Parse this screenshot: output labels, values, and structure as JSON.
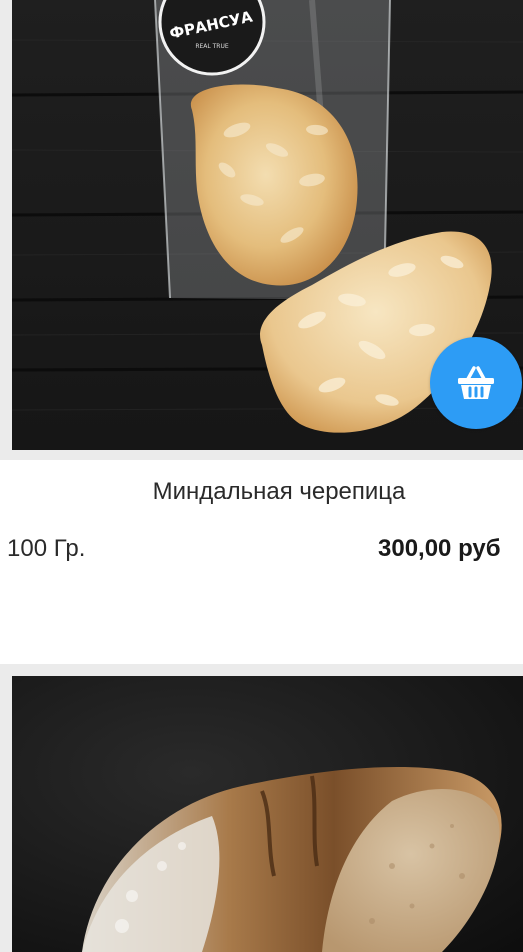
{
  "products": [
    {
      "name": "Миндальная черепица",
      "weight": "100 Гр.",
      "price": "300,00 руб",
      "package_label": "ФРАНСУА",
      "package_sublabel": "REAL TRUE",
      "cart_icon": "basket-icon"
    },
    {
      "image": "rustic-bread-loaf"
    }
  ],
  "colors": {
    "cart_button": "#2d9cf5",
    "frame": "#ebebeb",
    "text": "#2a2a2a"
  }
}
